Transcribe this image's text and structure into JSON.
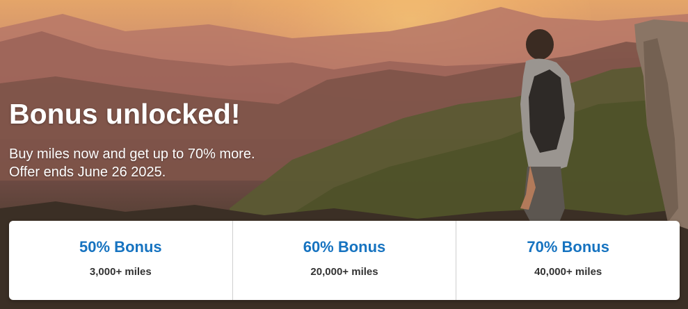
{
  "hero": {
    "headline": "Bonus unlocked!",
    "subtext_line1": "Buy miles now and get up to 70% more.",
    "subtext_line2": "Offer ends June 26 2025."
  },
  "offers": [
    {
      "title": "50% Bonus",
      "miles": "3,000+ miles"
    },
    {
      "title": "60% Bonus",
      "miles": "20,000+ miles"
    },
    {
      "title": "70% Bonus",
      "miles": "40,000+ miles"
    }
  ],
  "colors": {
    "offer_title": "#1673c0",
    "offer_miles": "#333333",
    "headline": "#ffffff"
  }
}
